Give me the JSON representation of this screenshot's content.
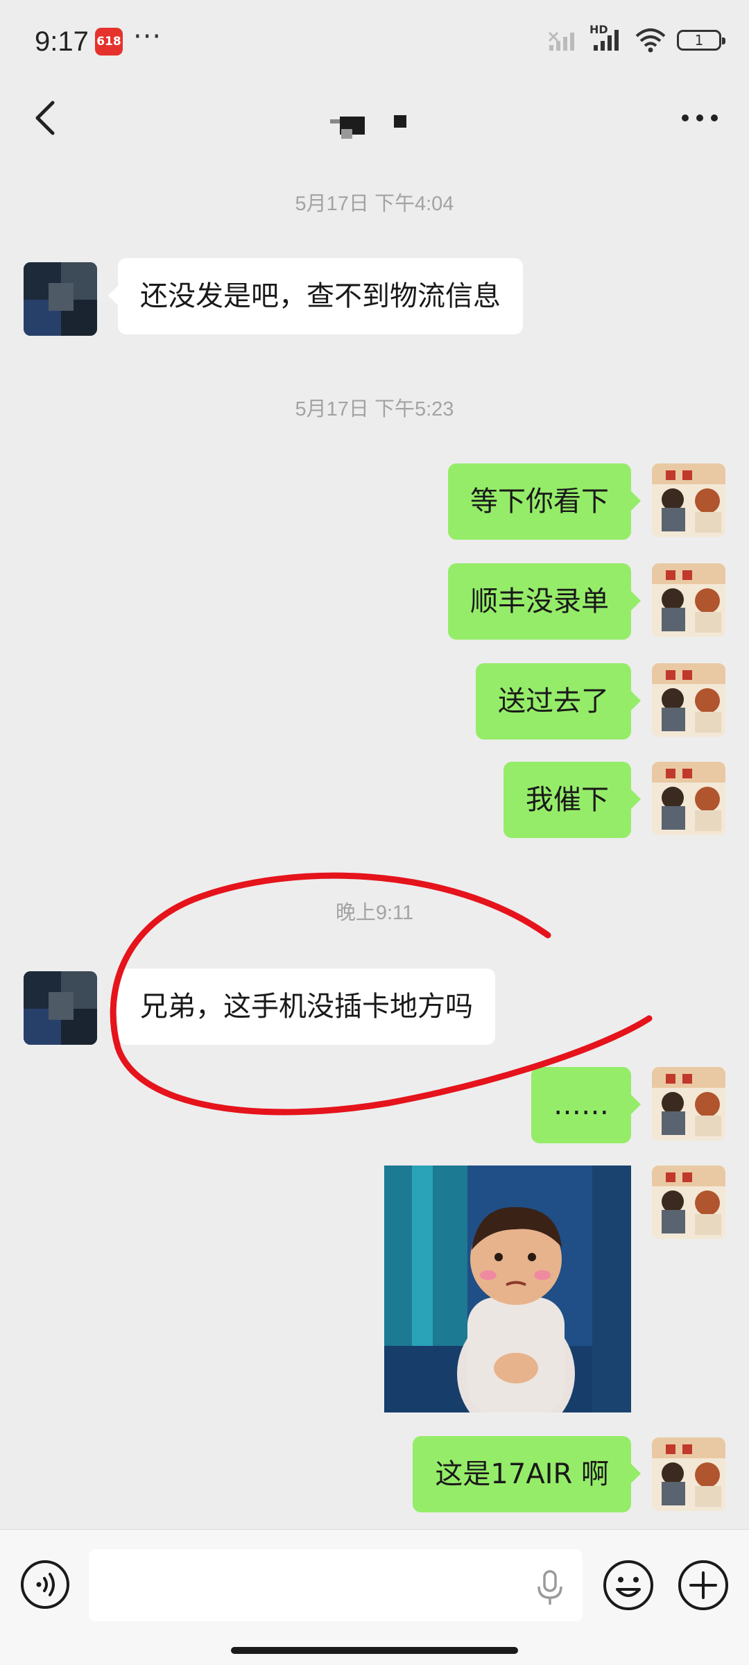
{
  "status_bar": {
    "time": "9:17",
    "app_badge": "618",
    "overflow": "···",
    "network_label": "HD",
    "battery_level": "1"
  },
  "nav": {
    "back_icon": "chevron-left-icon",
    "more_icon": "more-dots-icon"
  },
  "messages": [
    {
      "type": "timestamp",
      "text": "5月17日 下午4:04"
    },
    {
      "type": "incoming",
      "text": "还没发是吧，查不到物流信息"
    },
    {
      "type": "timestamp",
      "text": "5月17日 下午5:23"
    },
    {
      "type": "outgoing",
      "text": "等下你看下"
    },
    {
      "type": "outgoing",
      "text": "顺丰没录单"
    },
    {
      "type": "outgoing",
      "text": "送过去了"
    },
    {
      "type": "outgoing",
      "text": "我催下"
    },
    {
      "type": "timestamp",
      "text": "晚上9:11"
    },
    {
      "type": "incoming",
      "text": "兄弟，这手机没插卡地方吗"
    },
    {
      "type": "outgoing",
      "text": "……"
    },
    {
      "type": "outgoing",
      "kind": "sticker"
    },
    {
      "type": "outgoing",
      "text": "这是17AIR 啊"
    }
  ],
  "colors": {
    "background": "#ededed",
    "outgoing_bubble": "#95ec69",
    "incoming_bubble": "#ffffff",
    "annotation": "#e5131b"
  },
  "input_bar": {
    "icons": [
      "voice-icon",
      "microphone-icon",
      "emoji-icon",
      "plus-icon"
    ]
  }
}
